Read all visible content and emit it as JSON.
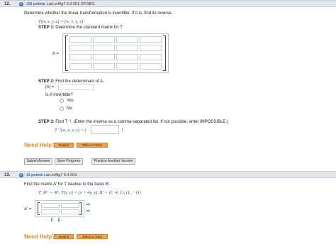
{
  "q12": {
    "number": "12.",
    "points": "-/19 points",
    "ref": "LarLinAlg7 6.3.501.XP.SBS.",
    "instruction": "Determine whether the linear transformation is invertible. If it is, find its inverse.",
    "transform": "T(w, x, y, z) = (w, x, y, z)",
    "step1": "STEP 1:",
    "step1_text": "Determine the standard matrix for T.",
    "matrix_label": "A =",
    "step2": "STEP 2:",
    "step2_text": "Find the determinant of A.",
    "det_label": "|A| =",
    "invertible_q": "Is A invertible?",
    "options": [
      "Yes",
      "No"
    ],
    "step3": "STEP 3:",
    "step3_text": "Find T⁻¹. (Enter the inverse as a comma-separated list. If not possible, enter IMPOSSIBLE.)",
    "inverse_label": "T⁻¹(w, x, y, z) = (",
    "inverse_close": ")",
    "need_help": "Need Help?",
    "read_it": "Read It",
    "talk_tutor": "Talk to a Tutor",
    "submit": "Submit Answer",
    "save": "Save Progress",
    "practice": "Practice Another Version"
  },
  "q13": {
    "number": "13.",
    "points": "-/1 points",
    "ref": "LarLinAlg7 6.4.003.",
    "instruction": "Find the matrix A′ for T relative to the basis B′.",
    "transform": "T: R² → R², T(x, y) = (x + 4y, y), B′ = {(−4, 1), (1, −1)}",
    "matrix_label": "A′ =",
    "need_help": "Need Help?",
    "read_it": "Read It",
    "talk_tutor": "Talk to a Tutor"
  },
  "colors": {
    "header_bg": "#e3e7ec",
    "link_blue": "#2b5fa8",
    "help_orange": "#ef8a1e",
    "button_orange": "#f4a34a",
    "arrow_green": "#3aa84a"
  },
  "icons": [
    "plus-circle-icon",
    "radio-icon",
    "arrow-right-icon",
    "arrow-down-icon"
  ]
}
